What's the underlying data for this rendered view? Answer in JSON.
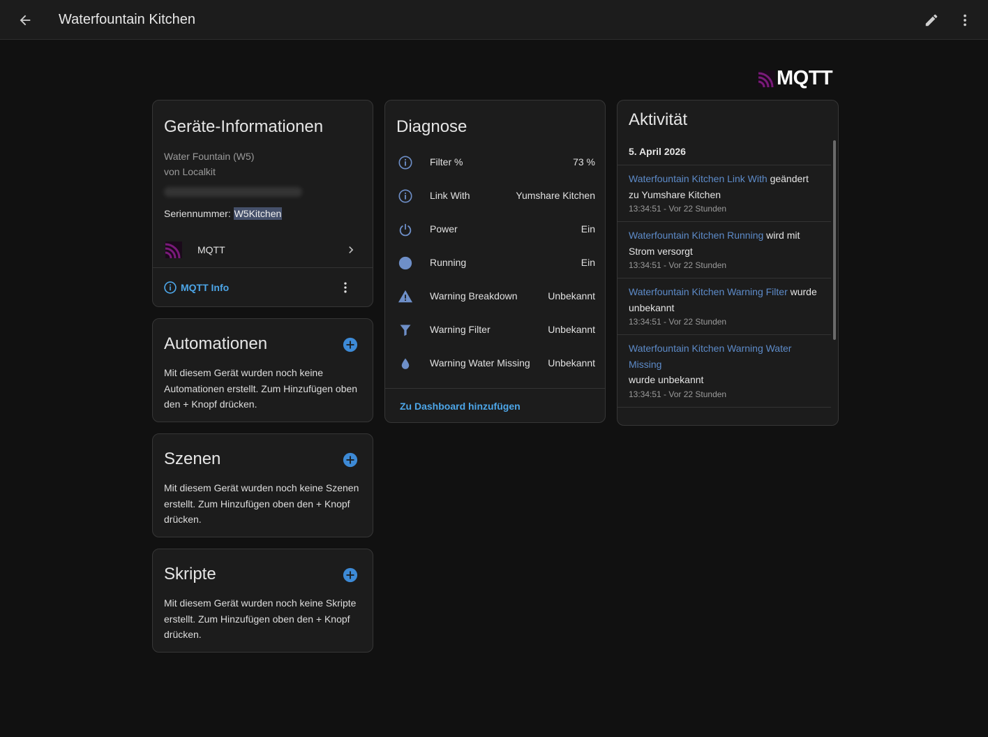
{
  "header": {
    "title": "Waterfountain Kitchen"
  },
  "logo": {
    "text": "MQTT",
    "color": "#660066"
  },
  "device_info": {
    "title": "Geräte-Informationen",
    "model": "Water Fountain (W5)",
    "manufacturer": "von Localkit",
    "serial_label": "Seriennummer: ",
    "serial_value": "W5Kitchen",
    "integration_label": "MQTT",
    "info_link": "MQTT Info"
  },
  "automations": {
    "title": "Automationen",
    "description": "Mit diesem Gerät wurden noch keine Automationen erstellt. Zum Hinzufügen oben den + Knopf drücken."
  },
  "scenes": {
    "title": "Szenen",
    "description": "Mit diesem Gerät wurden noch keine Szenen erstellt. Zum Hinzufügen oben den + Knopf drücken."
  },
  "scripts": {
    "title": "Skripte",
    "description": "Mit diesem Gerät wurden noch keine Skripte erstellt. Zum Hinzufügen oben den + Knopf drücken."
  },
  "diagnose": {
    "title": "Diagnose",
    "rows": [
      {
        "name": "Filter %",
        "value": "73 %",
        "icon": "info-circle-icon"
      },
      {
        "name": "Link With",
        "value": "Yumshare Kitchen",
        "icon": "info-circle-icon"
      },
      {
        "name": "Power",
        "value": "Ein",
        "icon": "power-icon"
      },
      {
        "name": "Running",
        "value": "Ein",
        "icon": "circle-icon"
      },
      {
        "name": "Warning Breakdown",
        "value": "Unbekannt",
        "icon": "warning-icon"
      },
      {
        "name": "Warning Filter",
        "value": "Unbekannt",
        "icon": "filter-icon"
      },
      {
        "name": "Warning Water Missing",
        "value": "Unbekannt",
        "icon": "water-drop-icon"
      }
    ],
    "dashboard_link": "Zu Dashboard hinzufügen"
  },
  "activity": {
    "title": "Aktivität",
    "date": "5. April 2026",
    "entries": [
      {
        "entity": "Waterfountain Kitchen Link With",
        "text": " geändert zu Yumshare Kitchen",
        "time": "13:34:51 - Vor 22 Stunden"
      },
      {
        "entity": "Waterfountain Kitchen Running",
        "text": " wird mit Strom versorgt",
        "time": "13:34:51 - Vor 22 Stunden"
      },
      {
        "entity": "Waterfountain Kitchen Warning Filter",
        "text": " wurde unbekannt",
        "time": "13:34:51 - Vor 22 Stunden"
      },
      {
        "entity": "Waterfountain Kitchen Warning Water Missing",
        "text": "wurde unbekannt",
        "time": "13:34:51 - Vor 22 Stunden"
      }
    ]
  },
  "colors": {
    "accent_link": "#4da6e8",
    "icon_blue": "#6e8fc8",
    "background": "#111111",
    "card": "#1c1c1c"
  }
}
